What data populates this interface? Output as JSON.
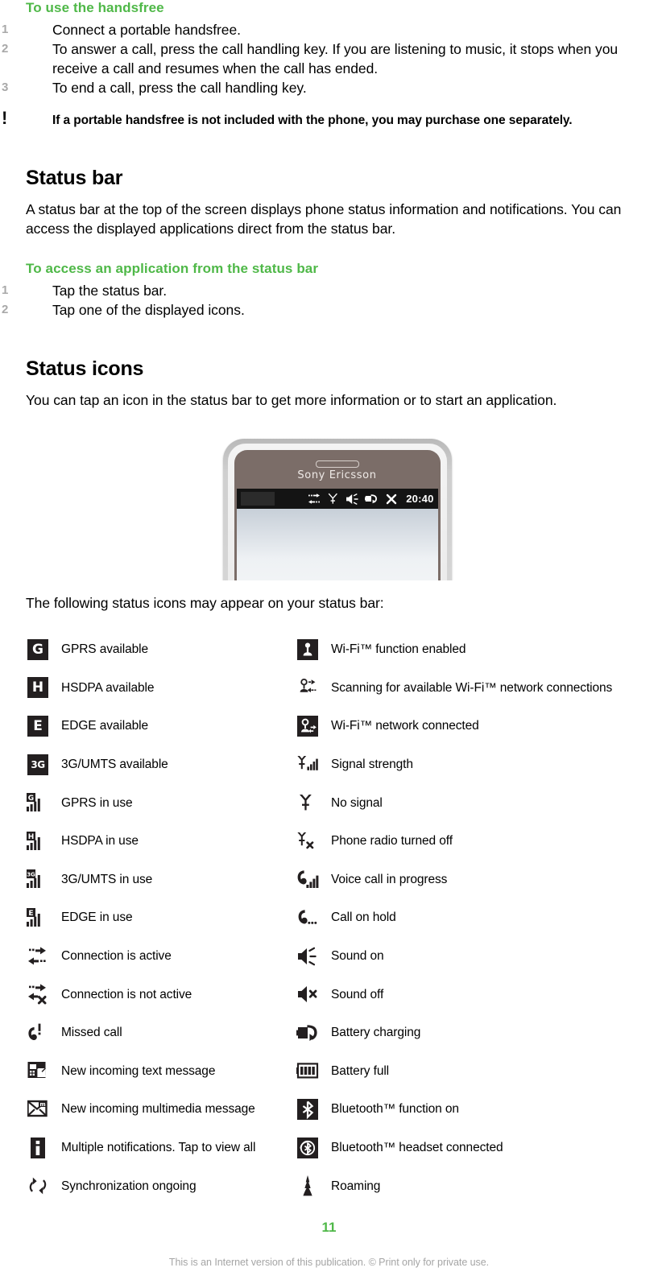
{
  "colors": {
    "accent_green": "#4fb848",
    "step_number_gray": "#a9a9a9",
    "icon_dark": "#231f20",
    "footer_gray": "#a5a5a5",
    "phone_body": "#7b6d68",
    "statusbar_black": "#141414"
  },
  "handsfree": {
    "heading": "To use the handsfree",
    "steps": [
      {
        "num": "1",
        "text": "Connect a portable handsfree."
      },
      {
        "num": "2",
        "text": "To answer a call, press the call handling key. If you are listening to music, it stops when you receive a call and resumes when the call has ended."
      },
      {
        "num": "3",
        "text": "To end a call, press the call handling key."
      }
    ],
    "tip_marker": "!",
    "tip": "If a portable handsfree is not included with the phone, you may purchase one separately."
  },
  "status_bar_section": {
    "heading": "Status bar",
    "body": "A status bar at the top of the screen displays phone status information and notifications. You can access the displayed applications direct from the status bar.",
    "proc_heading": "To access an application from the status bar",
    "steps": [
      {
        "num": "1",
        "text": "Tap the status bar."
      },
      {
        "num": "2",
        "text": "Tap one of the displayed icons."
      }
    ]
  },
  "status_icons_section": {
    "heading": "Status icons",
    "body": "You can tap an icon in the status bar to get more information or to start an application.",
    "intro": "The following status icons may appear on your status bar:"
  },
  "phone_illustration": {
    "brand": "Sony Ericsson",
    "statusbar": {
      "clock": "20:40",
      "icons": [
        "connection-active-icon",
        "no-signal-icon",
        "sound-on-icon",
        "battery-charging-icon",
        "close-x-icon"
      ]
    }
  },
  "legend": {
    "left": [
      {
        "icon": "gprs-available-icon",
        "glyph": "G",
        "label": "GPRS available"
      },
      {
        "icon": "hsdpa-available-icon",
        "glyph": "H",
        "label": "HSDPA available"
      },
      {
        "icon": "edge-available-icon",
        "glyph": "E",
        "label": "EDGE available"
      },
      {
        "icon": "3g-umts-available-icon",
        "glyph": "3G",
        "label": "3G/UMTS available"
      },
      {
        "icon": "gprs-in-use-icon",
        "glyph": "G",
        "label": "GPRS in use"
      },
      {
        "icon": "hsdpa-in-use-icon",
        "glyph": "H",
        "label": "HSDPA in use"
      },
      {
        "icon": "3g-umts-in-use-icon",
        "glyph": "3G",
        "label": "3G/UMTS in use"
      },
      {
        "icon": "edge-in-use-icon",
        "glyph": "E",
        "label": "EDGE in use"
      },
      {
        "icon": "connection-active-icon",
        "glyph": "",
        "label": "Connection is active"
      },
      {
        "icon": "connection-not-active-icon",
        "glyph": "",
        "label": "Connection is not active"
      },
      {
        "icon": "missed-call-icon",
        "glyph": "",
        "label": "Missed call"
      },
      {
        "icon": "new-text-message-icon",
        "glyph": "",
        "label": "New incoming text message"
      },
      {
        "icon": "new-multimedia-message-icon",
        "glyph": "",
        "label": "New incoming multimedia message"
      },
      {
        "icon": "multiple-notifications-icon",
        "glyph": "i",
        "label": "Multiple notifications. Tap to view all"
      },
      {
        "icon": "synchronization-ongoing-icon",
        "glyph": "",
        "label": "Synchronization ongoing"
      }
    ],
    "right": [
      {
        "icon": "wifi-enabled-icon",
        "glyph": "",
        "label": "Wi-Fi™ function enabled"
      },
      {
        "icon": "wifi-scanning-icon",
        "glyph": "",
        "label": "Scanning for available Wi-Fi™ network connections"
      },
      {
        "icon": "wifi-connected-icon",
        "glyph": "",
        "label": "Wi-Fi™ network connected"
      },
      {
        "icon": "signal-strength-icon",
        "glyph": "",
        "label": "Signal strength"
      },
      {
        "icon": "no-signal-icon",
        "glyph": "",
        "label": "No signal"
      },
      {
        "icon": "phone-radio-off-icon",
        "glyph": "",
        "label": "Phone radio turned off"
      },
      {
        "icon": "voice-call-in-progress-icon",
        "glyph": "",
        "label": "Voice call in progress"
      },
      {
        "icon": "call-on-hold-icon",
        "glyph": "",
        "label": "Call on hold"
      },
      {
        "icon": "sound-on-icon",
        "glyph": "",
        "label": "Sound on"
      },
      {
        "icon": "sound-off-icon",
        "glyph": "",
        "label": "Sound off"
      },
      {
        "icon": "battery-charging-icon",
        "glyph": "",
        "label": "Battery charging"
      },
      {
        "icon": "battery-full-icon",
        "glyph": "",
        "label": "Battery full"
      },
      {
        "icon": "bluetooth-on-icon",
        "glyph": "",
        "label": "Bluetooth™ function on"
      },
      {
        "icon": "bluetooth-headset-icon",
        "glyph": "",
        "label": "Bluetooth™ headset connected"
      },
      {
        "icon": "roaming-icon",
        "glyph": "",
        "label": "Roaming"
      }
    ]
  },
  "footer": {
    "page_number": "11",
    "disclaimer": "This is an Internet version of this publication. © Print only for private use."
  }
}
